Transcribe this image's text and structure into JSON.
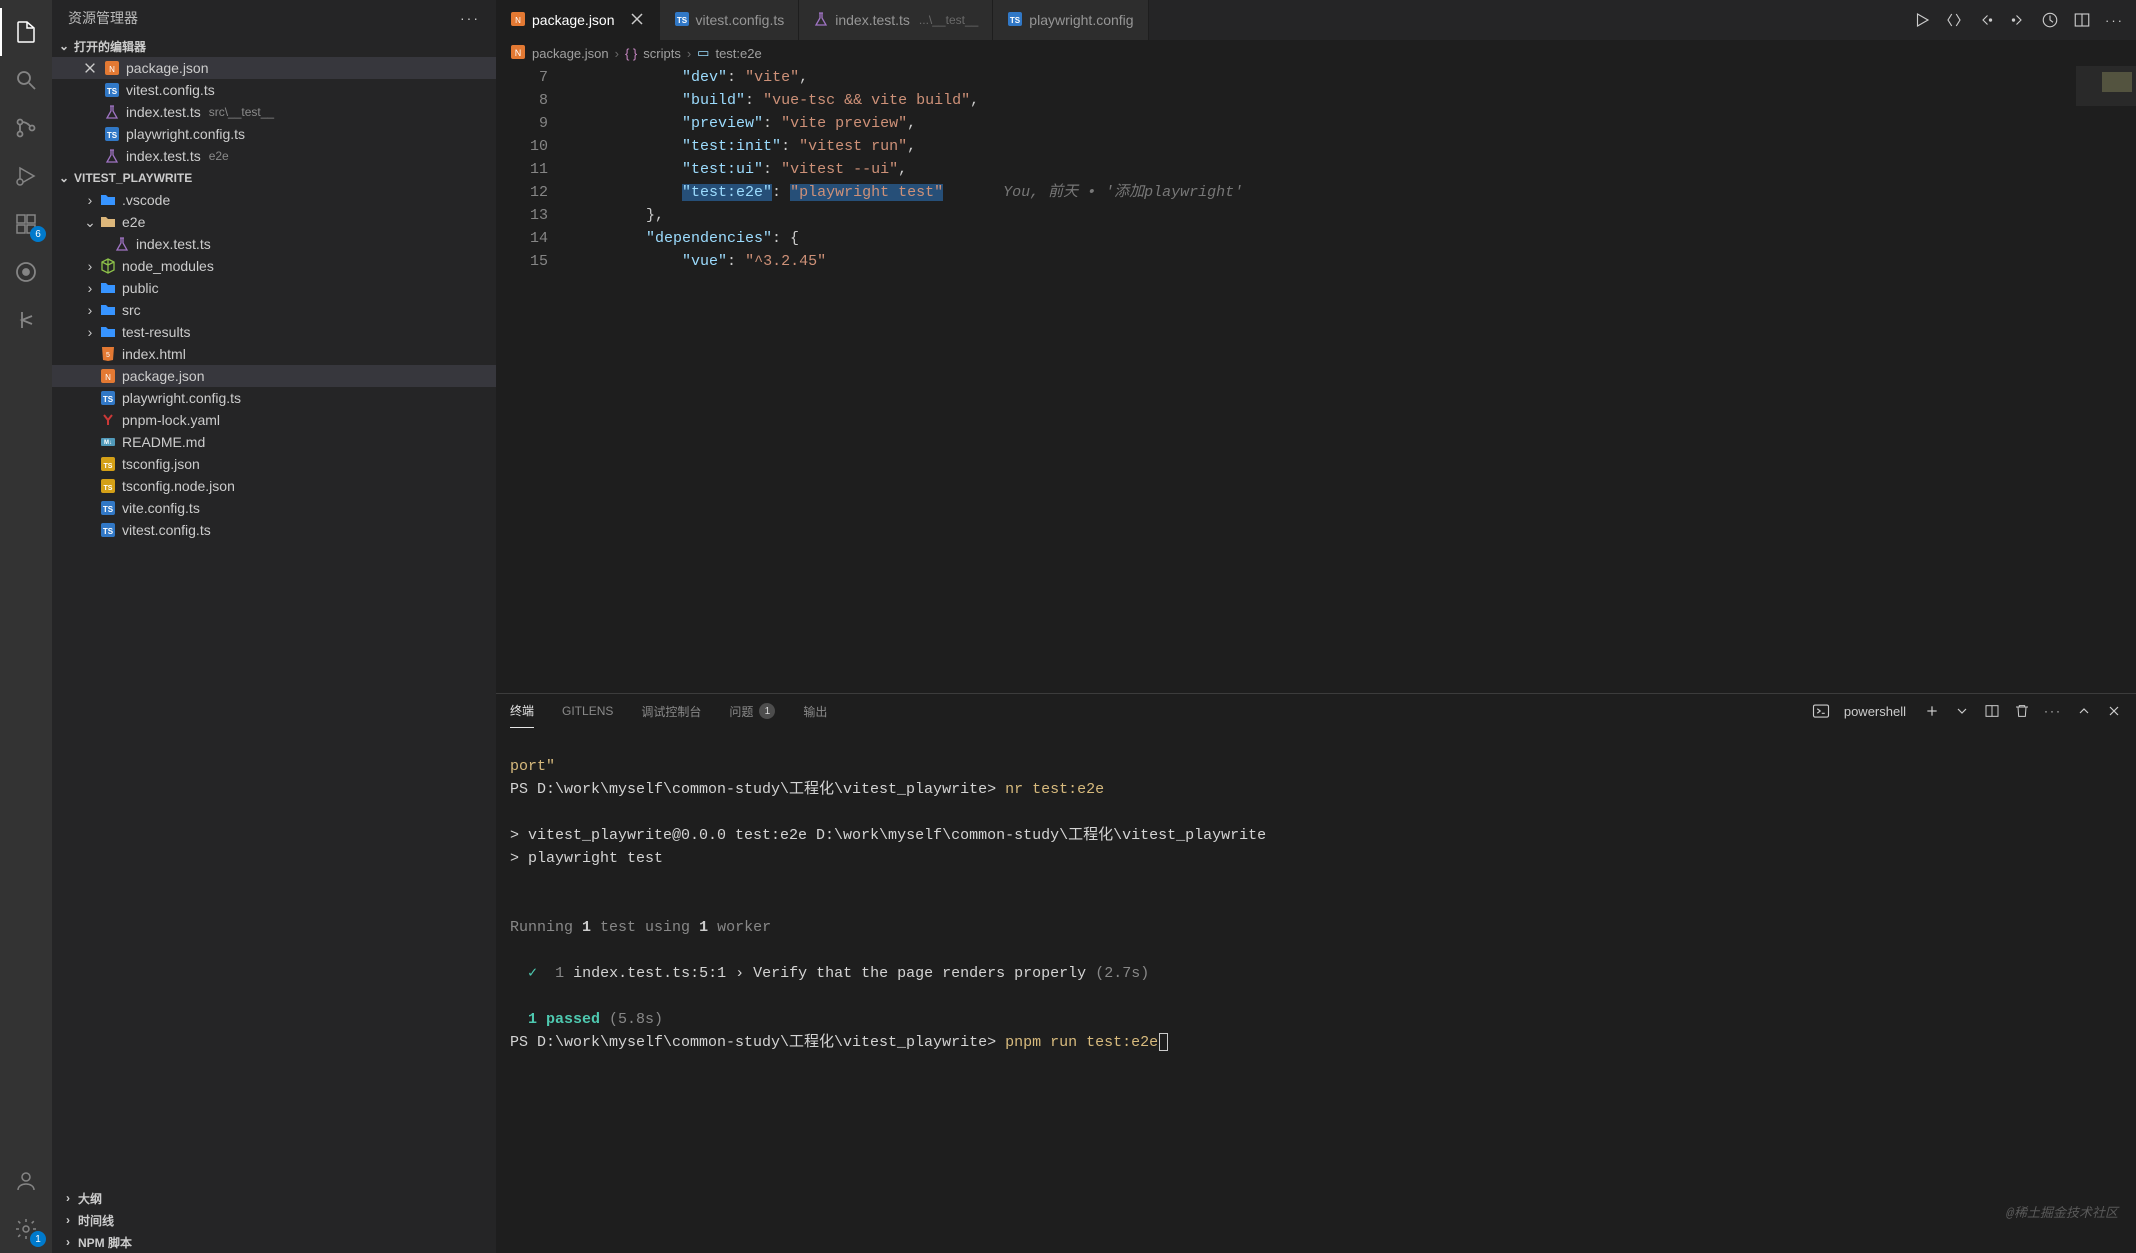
{
  "sidebar": {
    "title": "资源管理器",
    "openEditors": {
      "label": "打开的编辑器",
      "items": [
        {
          "name": "package.json",
          "meta": "",
          "icon": "json",
          "active": true
        },
        {
          "name": "vitest.config.ts",
          "meta": "",
          "icon": "ts"
        },
        {
          "name": "index.test.ts",
          "meta": "src\\__test__",
          "icon": "beaker"
        },
        {
          "name": "playwright.config.ts",
          "meta": "",
          "icon": "ts"
        },
        {
          "name": "index.test.ts",
          "meta": "e2e",
          "icon": "beaker"
        }
      ]
    },
    "project": {
      "label": "VITEST_PLAYWRITE",
      "items": [
        {
          "name": ".vscode",
          "icon": "folder",
          "depth": 1,
          "chev": "right"
        },
        {
          "name": "e2e",
          "icon": "folder-o",
          "depth": 1,
          "chev": "down"
        },
        {
          "name": "index.test.ts",
          "icon": "beaker",
          "depth": 2
        },
        {
          "name": "node_modules",
          "icon": "nm",
          "depth": 1,
          "chev": "right"
        },
        {
          "name": "public",
          "icon": "folder",
          "depth": 1,
          "chev": "right"
        },
        {
          "name": "src",
          "icon": "folder",
          "depth": 1,
          "chev": "right"
        },
        {
          "name": "test-results",
          "icon": "folder",
          "depth": 1,
          "chev": "right"
        },
        {
          "name": "index.html",
          "icon": "html",
          "depth": 1
        },
        {
          "name": "package.json",
          "icon": "json",
          "depth": 1,
          "active": true
        },
        {
          "name": "playwright.config.ts",
          "icon": "ts",
          "depth": 1
        },
        {
          "name": "pnpm-lock.yaml",
          "icon": "yarn",
          "depth": 1
        },
        {
          "name": "README.md",
          "icon": "md",
          "depth": 1
        },
        {
          "name": "tsconfig.json",
          "icon": "tsj",
          "depth": 1
        },
        {
          "name": "tsconfig.node.json",
          "icon": "tsj",
          "depth": 1
        },
        {
          "name": "vite.config.ts",
          "icon": "ts",
          "depth": 1
        },
        {
          "name": "vitest.config.ts",
          "icon": "ts",
          "depth": 1
        }
      ]
    },
    "bottom": [
      {
        "label": "大纲"
      },
      {
        "label": "时间线"
      },
      {
        "label": "NPM 脚本"
      }
    ]
  },
  "activityBadges": {
    "ext": "6",
    "gear": "1"
  },
  "tabs": [
    {
      "name": "package.json",
      "icon": "json",
      "active": true,
      "close": true
    },
    {
      "name": "vitest.config.ts",
      "icon": "ts"
    },
    {
      "name": "index.test.ts",
      "icon": "beaker",
      "meta": "...\\__test__"
    },
    {
      "name": "playwright.config",
      "icon": "ts",
      "trunc": true
    }
  ],
  "breadcrumb": {
    "file": "package.json",
    "sym1": "scripts",
    "sym2": "test:e2e"
  },
  "editor": {
    "lines": [
      {
        "n": 7,
        "indent": 3,
        "key": "dev",
        "val": "vite",
        "after": ","
      },
      {
        "n": 8,
        "indent": 3,
        "key": "build",
        "val": "vue-tsc && vite build",
        "after": ","
      },
      {
        "n": 9,
        "indent": 3,
        "key": "preview",
        "val": "vite preview",
        "after": ","
      },
      {
        "n": 10,
        "indent": 3,
        "key": "test:init",
        "val": "vitest run",
        "after": ","
      },
      {
        "n": 11,
        "indent": 3,
        "key": "test:ui",
        "val": "vitest --ui",
        "after": ","
      },
      {
        "n": 12,
        "indent": 3,
        "key": "test:e2e",
        "val": "playwright test",
        "after": "",
        "hl": true,
        "lens": "You, 前天 • '添加playwright'"
      },
      {
        "n": 13,
        "indent": 2,
        "raw": "},"
      },
      {
        "n": 14,
        "indent": 2,
        "key": "dependencies",
        "obj": true
      },
      {
        "n": 15,
        "indent": 3,
        "key": "vue",
        "val": "^3.2.45",
        "after": ""
      }
    ]
  },
  "panel": {
    "tabs": {
      "terminal": "终端",
      "gitlens": "GITLENS",
      "debug": "调试控制台",
      "problems": "问题",
      "problemsBadge": "1",
      "output": "输出"
    },
    "shell": "powershell"
  },
  "terminal": {
    "l1": "port\"",
    "l2_ps": "PS D:\\work\\myself\\common-study\\工程化\\vitest_playwrite>",
    "l2_cmd": "nr test:e2e",
    "l3": "> vitest_playwrite@0.0.0 test:e2e D:\\work\\myself\\common-study\\工程化\\vitest_playwrite",
    "l4": "> playwright test",
    "l5_a": "Running ",
    "l5_b": "1",
    "l5_c": " test using ",
    "l5_d": "1",
    "l5_e": " worker",
    "l6_check": "✓",
    "l6_num": "1",
    "l6_rest": "index.test.ts:5:1 › Verify that the page renders properly",
    "l6_time": "(2.7s)",
    "l7_a": "1 passed",
    "l7_b": " (5.8s)",
    "l8_ps": "PS D:\\work\\myself\\common-study\\工程化\\vitest_playwrite>",
    "l8_cmd": "pnpm run test:e2e"
  },
  "watermark": "@稀土掘金技术社区"
}
